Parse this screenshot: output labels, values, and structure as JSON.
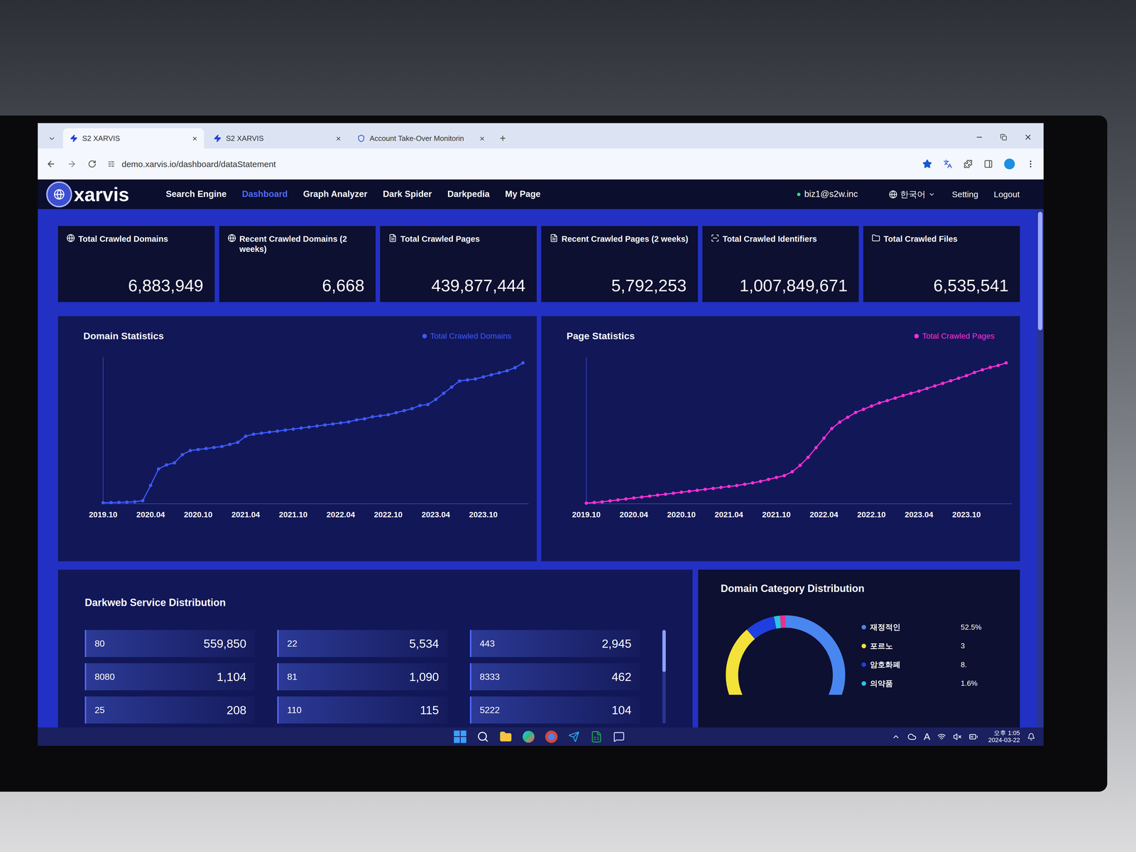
{
  "browser": {
    "tabs": [
      {
        "label": "S2 XARVIS",
        "selected": true,
        "close": "×"
      },
      {
        "label": "S2 XARVIS",
        "selected": false,
        "close": "×"
      },
      {
        "label": "Account Take-Over Monitorin",
        "selected": false,
        "close": "×"
      }
    ],
    "new_tab": "+",
    "url": "demo.xarvis.io/dashboard/dataStatement"
  },
  "app": {
    "logo": "xarvis",
    "nav": [
      {
        "label": "Search Engine",
        "selected": false
      },
      {
        "label": "Dashboard",
        "selected": true
      },
      {
        "label": "Graph Analyzer",
        "selected": false
      },
      {
        "label": "Dark Spider",
        "selected": false
      },
      {
        "label": "Darkpedia",
        "selected": false
      },
      {
        "label": "My Page",
        "selected": false
      }
    ],
    "user": "biz1@s2w.inc",
    "language": "한국어",
    "links": [
      "Setting",
      "Logout"
    ]
  },
  "stats": [
    {
      "title": "Total Crawled Domains",
      "value": "6,883,949",
      "kind": "globe"
    },
    {
      "title": "Recent Crawled Domains (2 weeks)",
      "value": "6,668",
      "kind": "globe"
    },
    {
      "title": "Total Crawled Pages",
      "value": "439,877,444",
      "kind": "page"
    },
    {
      "title": "Recent Crawled Pages (2 weeks)",
      "value": "5,792,253",
      "kind": "page"
    },
    {
      "title": "Total Crawled Identifiers",
      "value": "1,007,849,671",
      "kind": "identifier"
    },
    {
      "title": "Total Crawled Files",
      "value": "6,535,541",
      "kind": "file"
    }
  ],
  "domain_chart": {
    "title": "Domain Statistics",
    "legend": "Total Crawled Domains",
    "color": "#3d5afe",
    "ticks": [
      "2019.10",
      "2020.04",
      "2020.10",
      "2021.04",
      "2021.10",
      "2022.04",
      "2022.10",
      "2023.04",
      "2023.10"
    ],
    "values": [
      50000,
      60000,
      70000,
      80000,
      100000,
      150000,
      900000,
      1700000,
      1900000,
      2000000,
      2400000,
      2600000,
      2650000,
      2700000,
      2750000,
      2800000,
      2900000,
      3000000,
      3300000,
      3400000,
      3450000,
      3500000,
      3550000,
      3600000,
      3650000,
      3700000,
      3750000,
      3800000,
      3850000,
      3900000,
      3950000,
      4000000,
      4100000,
      4150000,
      4250000,
      4300000,
      4350000,
      4450000,
      4550000,
      4650000,
      4800000,
      4850000,
      5100000,
      5400000,
      5700000,
      6000000,
      6050000,
      6100000,
      6200000,
      6300000,
      6400000,
      6500000,
      6650000,
      6883949
    ]
  },
  "page_chart": {
    "title": "Page Statistics",
    "legend": "Total Crawled Pages",
    "color": "#ff2fd8",
    "ticks": [
      "2019.10",
      "2020.04",
      "2020.10",
      "2021.04",
      "2021.10",
      "2022.04",
      "2022.10",
      "2023.04",
      "2023.10"
    ],
    "values": [
      2000000,
      4000000,
      6000000,
      9000000,
      12000000,
      15000000,
      18000000,
      21000000,
      24000000,
      27000000,
      30000000,
      33000000,
      36000000,
      39000000,
      42000000,
      45000000,
      48000000,
      51000000,
      54000000,
      57000000,
      61000000,
      65000000,
      70000000,
      76000000,
      82000000,
      88000000,
      100000000,
      120000000,
      145000000,
      175000000,
      205000000,
      235000000,
      255000000,
      270000000,
      285000000,
      295000000,
      305000000,
      315000000,
      322000000,
      330000000,
      338000000,
      345000000,
      352000000,
      360000000,
      368000000,
      376000000,
      384000000,
      392000000,
      400000000,
      410000000,
      418000000,
      426000000,
      432000000,
      439877444
    ]
  },
  "services": {
    "title": "Darkweb Service Distribution",
    "columns": [
      [
        {
          "port": "80",
          "count": "559,850"
        },
        {
          "port": "8080",
          "count": "1,104"
        },
        {
          "port": "25",
          "count": "208"
        }
      ],
      [
        {
          "port": "22",
          "count": "5,534"
        },
        {
          "port": "81",
          "count": "1,090"
        },
        {
          "port": "110",
          "count": "115"
        }
      ],
      [
        {
          "port": "443",
          "count": "2,945"
        },
        {
          "port": "8333",
          "count": "462"
        },
        {
          "port": "5222",
          "count": "104"
        }
      ]
    ]
  },
  "categories": {
    "title": "Domain Category Distribution",
    "items": [
      {
        "label": "재정적인",
        "percent": "52.5%",
        "value": 52.5,
        "color": "#4a86f0"
      },
      {
        "label": "포르노",
        "percent": "3",
        "value": 35,
        "color": "#f2e23a"
      },
      {
        "label": "암호화폐",
        "percent": "8.",
        "value": 8,
        "color": "#1f3fe0"
      },
      {
        "label": "의약품",
        "percent": "1.6%",
        "value": 1.6,
        "color": "#29c6e0"
      }
    ],
    "extra_segments": [
      {
        "value": 1.5,
        "color": "#e8308f"
      }
    ]
  },
  "taskbar": {
    "tray_letter": "A",
    "time": "오후 1:05",
    "date": "2024-03-22"
  }
}
